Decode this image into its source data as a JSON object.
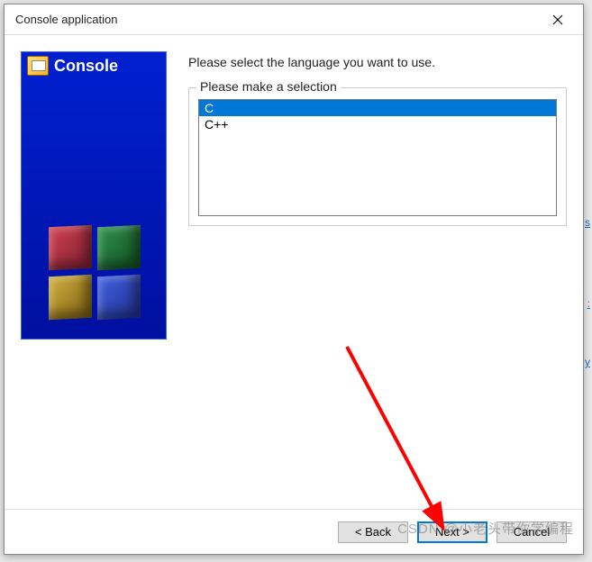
{
  "dialog": {
    "title": "Console application"
  },
  "sidebar": {
    "label": "Console"
  },
  "main": {
    "instruction": "Please select the language you want to use.",
    "fieldset_legend": "Please make a selection",
    "options": [
      {
        "label": "C",
        "selected": true
      },
      {
        "label": "C++",
        "selected": false
      }
    ]
  },
  "buttons": {
    "back": "< Back",
    "next": "Next >",
    "cancel": "Cancel"
  },
  "watermark": "CSDN @小老头带你学编程"
}
